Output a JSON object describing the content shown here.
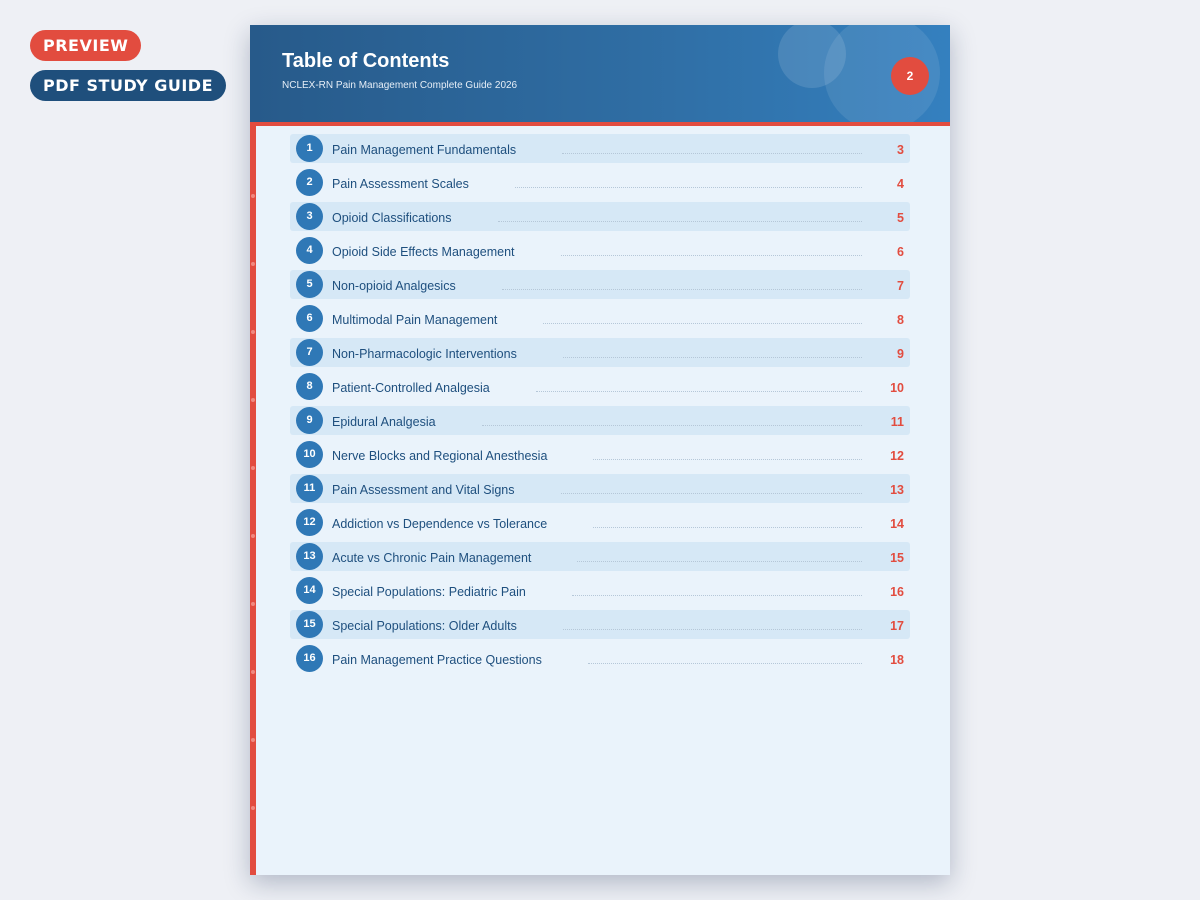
{
  "badges": {
    "preview": "PREVIEW",
    "guide": "PDF STUDY GUIDE"
  },
  "header": {
    "title": "Table of Contents",
    "subtitle": "NCLEX-RN Pain Management Complete Guide 2026",
    "page_number": "2"
  },
  "colors": {
    "accent_red": "#e24c3f",
    "header_blue": "#2f6da3",
    "navy": "#1f4f7c",
    "page_bg": "#eaf3fb",
    "row_shade": "#d6e8f6"
  },
  "toc": [
    {
      "num": "1",
      "title": "Pain Management Fundamentals",
      "page": "3"
    },
    {
      "num": "2",
      "title": "Pain Assessment Scales",
      "page": "4"
    },
    {
      "num": "3",
      "title": "Opioid Classifications",
      "page": "5"
    },
    {
      "num": "4",
      "title": "Opioid Side Effects Management",
      "page": "6"
    },
    {
      "num": "5",
      "title": "Non-opioid Analgesics",
      "page": "7"
    },
    {
      "num": "6",
      "title": "Multimodal Pain Management",
      "page": "8"
    },
    {
      "num": "7",
      "title": "Non-Pharmacologic Interventions",
      "page": "9"
    },
    {
      "num": "8",
      "title": "Patient-Controlled Analgesia",
      "page": "10"
    },
    {
      "num": "9",
      "title": "Epidural Analgesia",
      "page": "11"
    },
    {
      "num": "10",
      "title": "Nerve Blocks and Regional Anesthesia",
      "page": "12"
    },
    {
      "num": "11",
      "title": "Pain Assessment and Vital Signs",
      "page": "13"
    },
    {
      "num": "12",
      "title": "Addiction vs Dependence vs Tolerance",
      "page": "14"
    },
    {
      "num": "13",
      "title": "Acute vs Chronic Pain Management",
      "page": "15"
    },
    {
      "num": "14",
      "title": "Special Populations: Pediatric Pain",
      "page": "16"
    },
    {
      "num": "15",
      "title": "Special Populations: Older Adults",
      "page": "17"
    },
    {
      "num": "16",
      "title": "Pain Management Practice Questions",
      "page": "18"
    }
  ]
}
